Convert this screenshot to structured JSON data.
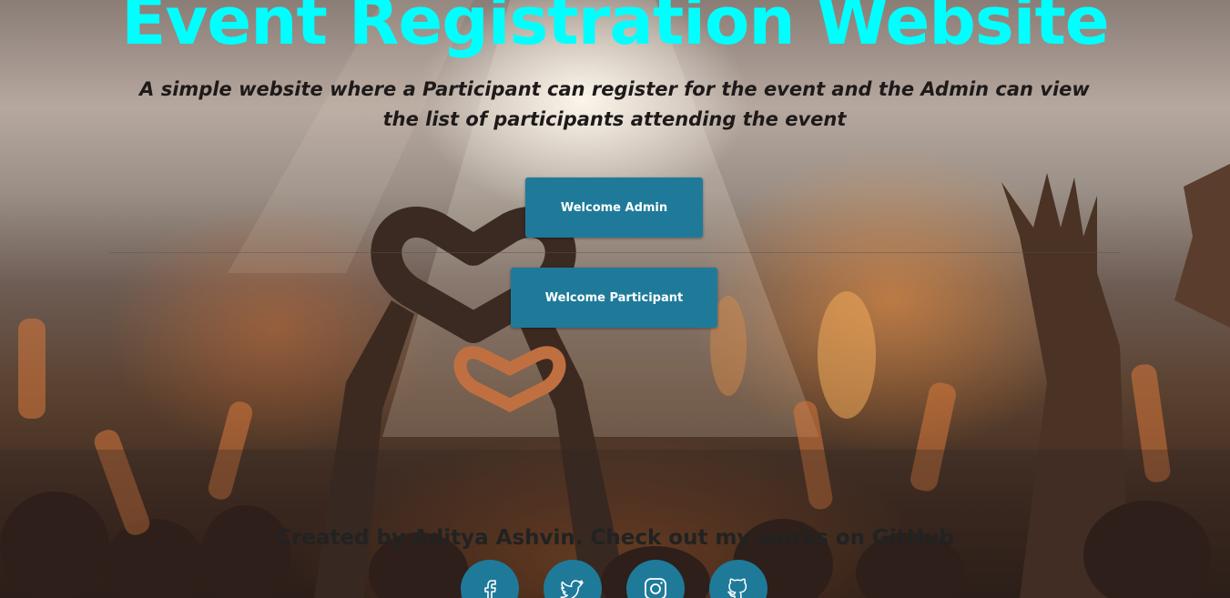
{
  "hero": {
    "title": "Event Registration Website",
    "subtitle": "A simple website where a Participant can register for the event and the Admin can view the list of participants attending the event"
  },
  "buttons": {
    "admin_label": "Welcome Admin",
    "participant_label": "Welcome Participant"
  },
  "footer": {
    "credit": "Created by Aditya Ashvin. Check out my works on GitHub",
    "social": [
      {
        "icon": "facebook-icon"
      },
      {
        "icon": "twitter-icon"
      },
      {
        "icon": "instagram-icon"
      },
      {
        "icon": "github-icon"
      }
    ]
  },
  "colors": {
    "title": "#00ffff",
    "button": "#1f7a9a",
    "button_text": "#ffffff"
  }
}
